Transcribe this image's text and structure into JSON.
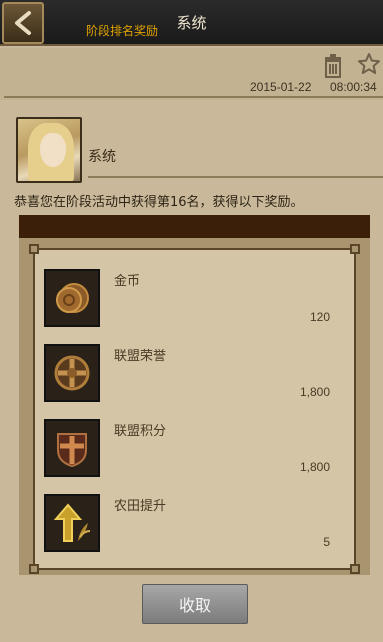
{
  "topbar": {
    "title": "系统",
    "back_icon": "chevron-left-icon"
  },
  "mail": {
    "subtitle": "阶段排名奖励",
    "date": "2015-01-22",
    "time": "08:00:34",
    "sender": "系统",
    "message": "恭喜您在阶段活动中获得第16名，获得以下奖励。"
  },
  "rewards": [
    {
      "name": "金币",
      "quantity": "120",
      "icon": "gold-coin-icon"
    },
    {
      "name": "联盟荣誉",
      "quantity": "1,800",
      "icon": "alliance-honor-icon"
    },
    {
      "name": "联盟积分",
      "quantity": "1,800",
      "icon": "alliance-points-icon"
    },
    {
      "name": "农田提升",
      "quantity": "5",
      "icon": "farm-upgrade-icon"
    }
  ],
  "actions": {
    "collect_label": "收取"
  },
  "colors": {
    "subtitle": "#e0a200",
    "panel_header": "#3b1f08",
    "background": "#c9b99a"
  }
}
